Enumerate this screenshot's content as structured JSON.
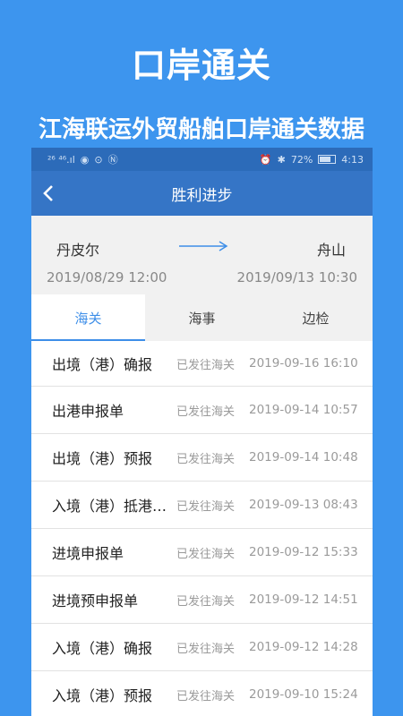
{
  "promo": {
    "title": "口岸通关",
    "subtitle": "江海联运外贸船舶口岸通关数据"
  },
  "statusbar": {
    "left_text": "²⁶ ⁴⁶.ıl",
    "battery_text": "72%",
    "time": "4:13"
  },
  "header": {
    "title": "胜利进步"
  },
  "route": {
    "from_port": "丹皮尔",
    "to_port": "舟山",
    "from_time": "2019/08/29 12:00",
    "to_time": "2019/09/13 10:30"
  },
  "tabs": [
    {
      "label": "海关",
      "active": true
    },
    {
      "label": "海事",
      "active": false
    },
    {
      "label": "边检",
      "active": false
    }
  ],
  "records": [
    {
      "name": "出境（港）确报",
      "status": "已发往海关",
      "time": "2019-09-16 16:10"
    },
    {
      "name": "出港申报单",
      "status": "已发往海关",
      "time": "2019-09-14 10:57"
    },
    {
      "name": "出境（港）预报",
      "status": "已发往海关",
      "time": "2019-09-14 10:48"
    },
    {
      "name": "入境（港）抵港…",
      "status": "已发往海关",
      "time": "2019-09-13 08:43"
    },
    {
      "name": "进境申报单",
      "status": "已发往海关",
      "time": "2019-09-12 15:33"
    },
    {
      "name": "进境预申报单",
      "status": "已发往海关",
      "time": "2019-09-12 14:51"
    },
    {
      "name": "入境（港）确报",
      "status": "已发往海关",
      "time": "2019-09-12 14:28"
    },
    {
      "name": "入境（港）预报",
      "status": "已发往海关",
      "time": "2019-09-10 15:24"
    }
  ],
  "colors": {
    "background": "#3d95ee",
    "statusbar": "#2c6bb9",
    "navbar": "#3575c6",
    "accent": "#3d8ee8"
  }
}
